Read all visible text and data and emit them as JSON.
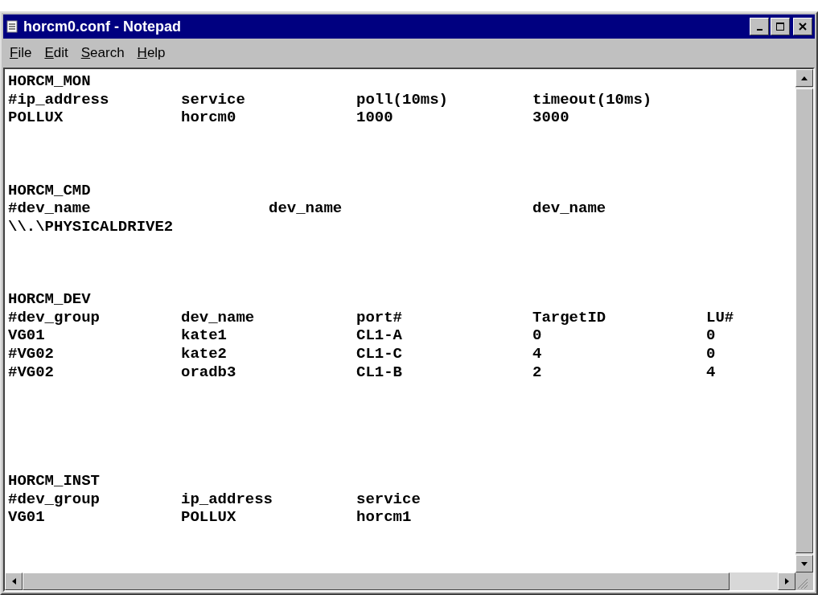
{
  "window": {
    "title": "horcm0.conf - Notepad"
  },
  "menu": [
    {
      "label": "File",
      "underline_first": true
    },
    {
      "label": "Edit",
      "underline_first": true
    },
    {
      "label": "Search",
      "underline_first": true
    },
    {
      "label": "Help",
      "underline_first": true
    }
  ],
  "sections": [
    {
      "kind": "table",
      "header": "HORCM_MON",
      "rows": [
        [
          "#ip_address",
          "service",
          "poll(10ms)",
          "timeout(10ms)"
        ],
        [
          "POLLUX",
          "horcm0",
          "1000",
          "3000"
        ]
      ]
    },
    {
      "kind": "wide",
      "header": "HORCM_CMD",
      "rows": [
        [
          "#dev_name",
          "dev_name",
          "dev_name"
        ],
        [
          "\\\\.\\PHYSICALDRIVE2"
        ]
      ]
    },
    {
      "kind": "table",
      "header": "HORCM_DEV",
      "rows": [
        [
          "#dev_group",
          "dev_name",
          "port#",
          "TargetID",
          "LU#"
        ],
        [
          "VG01",
          "kate1",
          "CL1-A",
          "0",
          "0"
        ],
        [
          "#VG02",
          "kate2",
          "CL1-C",
          "4",
          "0"
        ],
        [
          "#VG02",
          "oradb3",
          "CL1-B",
          "2",
          "4"
        ]
      ]
    },
    {
      "kind": "table",
      "header": "HORCM_INST",
      "rows": [
        [
          "#dev_group",
          "ip_address",
          "service"
        ],
        [
          "VG01",
          "POLLUX",
          "horcm1"
        ]
      ]
    }
  ]
}
